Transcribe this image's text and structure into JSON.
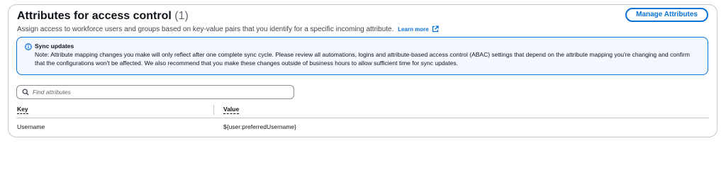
{
  "section": {
    "title": "Attributes for access control",
    "count": "(1)",
    "description": "Assign access to workforce users and groups based on key-value pairs that you identify for a specific incoming attribute.",
    "learn_more": "Learn more",
    "manage_button": "Manage Attributes"
  },
  "alert": {
    "icon": "info-icon",
    "title": "Sync updates",
    "body": "Note: Attribute mapping changes you make will only reflect after one complete sync cycle. Please review all automations, logins and attribute-based access control (ABAC) settings that depend on the attribute mapping you're changing and confirm that the configurations won't be affected. We also recommend that you make these changes outside of business hours to allow sufficient time for sync updates."
  },
  "search": {
    "placeholder": "Find attributes",
    "value": ""
  },
  "table": {
    "columns": [
      "Key",
      "Value"
    ],
    "rows": [
      [
        "Username",
        "${user:preferredUsername}"
      ]
    ]
  },
  "colors": {
    "accent": "#0972d3",
    "alert_background": "#f2f8fd",
    "border": "#c6c6cd"
  }
}
